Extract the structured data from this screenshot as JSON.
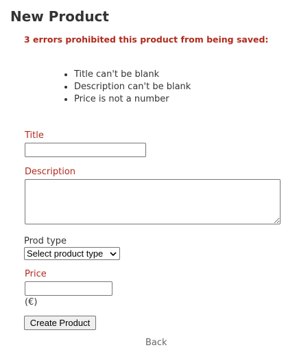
{
  "page": {
    "title": "New Product"
  },
  "errors": {
    "heading": "3 errors prohibited this product from being saved:",
    "items": [
      "Title can't be blank",
      "Description can't be blank",
      "Price is not a number"
    ]
  },
  "form": {
    "title": {
      "label": "Title",
      "value": ""
    },
    "description": {
      "label": "Description",
      "value": ""
    },
    "prod_type": {
      "label": "Prod type",
      "selected": "Select product type"
    },
    "price": {
      "label": "Price",
      "value": "",
      "unit": "(€)"
    },
    "submit_label": "Create Product"
  },
  "nav": {
    "back_label": "Back"
  },
  "colors": {
    "error": "#b02a1e",
    "text": "#333333",
    "muted_link": "#666666"
  }
}
